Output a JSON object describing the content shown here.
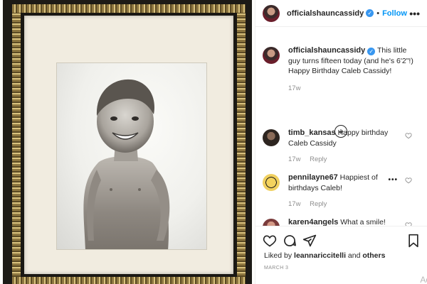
{
  "post": {
    "username": "officialshauncassidy",
    "follow_separator": "•",
    "follow_label": "Follow",
    "more_icon": "more-options-icon"
  },
  "caption": {
    "username": "officialshauncassidy",
    "text": "This little guy turns fifteen today (and he's 6'2\"!) Happy Birthday Caleb Cassidy!",
    "age": "17w"
  },
  "load_more_icon": "plus-circle-icon",
  "comments": [
    {
      "username": "timb_kansas",
      "text": "Happy birthday Caleb Cassidy",
      "age": "17w",
      "reply": "Reply"
    },
    {
      "username": "pennilayne67",
      "text": "Happiest of birthdays Caleb!",
      "age": "17w",
      "reply": "Reply"
    },
    {
      "username": "karen4angels",
      "text": "What a smile!"
    }
  ],
  "actions": {
    "liked_by_prefix": "Liked by",
    "liked_by_user": "leannariccitelli",
    "liked_by_and": "and",
    "liked_by_others": "others",
    "date": "MARCH 3",
    "add_comment_fragment": "Ad"
  }
}
